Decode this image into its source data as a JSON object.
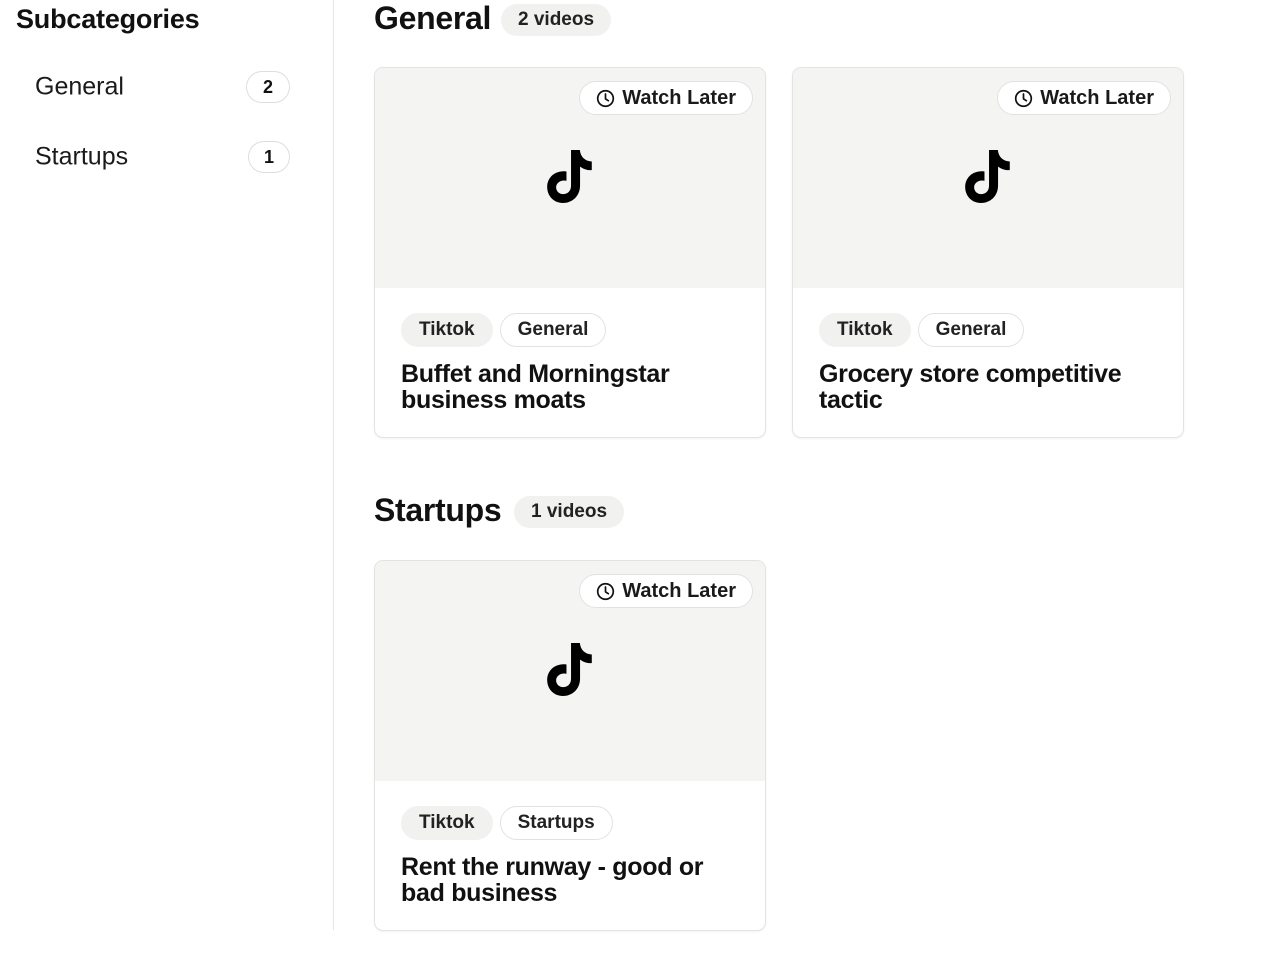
{
  "sidebar": {
    "title": "Subcategories",
    "items": [
      {
        "label": "General",
        "count": "2"
      },
      {
        "label": "Startups",
        "count": "1"
      }
    ]
  },
  "sections": [
    {
      "title": "General",
      "count_label": "2 videos",
      "videos": [
        {
          "watch_later": "Watch Later",
          "platform": "Tiktok",
          "category": "General",
          "title": "Buffet and Morningstar business moats"
        },
        {
          "watch_later": "Watch Later",
          "platform": "Tiktok",
          "category": "General",
          "title": "Grocery store competitive tactic"
        }
      ]
    },
    {
      "title": "Startups",
      "count_label": "1 videos",
      "videos": [
        {
          "watch_later": "Watch Later",
          "platform": "Tiktok",
          "category": "Startups",
          "title": "Rent the runway - good or bad business"
        }
      ]
    }
  ],
  "icons": {
    "thumbnail": "tiktok-icon",
    "watch_later": "clock-icon"
  },
  "colors": {
    "thumbnail_bg": "#f4f4f3",
    "pill_bg": "#f1f1f0",
    "border": "#e3e3e3",
    "text": "#111111"
  }
}
